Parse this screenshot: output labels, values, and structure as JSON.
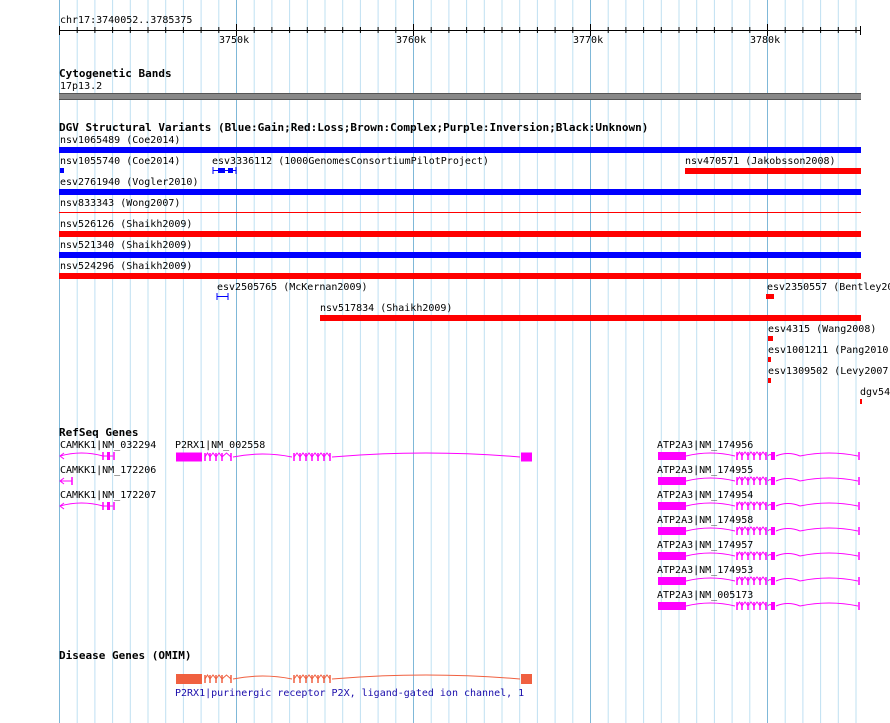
{
  "ruler": {
    "location": "chr17:3740052..3785375",
    "ticks": [
      "3750k",
      "3760k",
      "3770k",
      "3780k"
    ]
  },
  "cytoband": {
    "title": "Cytogenetic Bands",
    "band_label": "17p13.2"
  },
  "dgv": {
    "title": "DGV Structural Variants (Blue:Gain;Red:Loss;Brown:Complex;Purple:Inversion;Black:Unknown)",
    "colors": {
      "gain": "#0000ff",
      "loss": "#ff0000"
    },
    "variants": [
      {
        "label": "nsv1065489 (Coe2014)",
        "type": "gain"
      },
      {
        "label": "nsv1055740 (Coe2014)",
        "type": "gain"
      },
      {
        "label": "esv3336112 (1000GenomesConsortiumPilotProject)",
        "type": "gain"
      },
      {
        "label": "nsv470571 (Jakobsson2008)",
        "type": "loss"
      },
      {
        "label": "esv2761940 (Vogler2010)",
        "type": "gain"
      },
      {
        "label": "nsv833343 (Wong2007)",
        "type": "loss"
      },
      {
        "label": "nsv526126 (Shaikh2009)",
        "type": "loss"
      },
      {
        "label": "nsv521340 (Shaikh2009)",
        "type": "gain"
      },
      {
        "label": "nsv524296 (Shaikh2009)",
        "type": "loss"
      },
      {
        "label": "esv2505765 (McKernan2009)",
        "type": "gain"
      },
      {
        "label": "esv2350557 (Bentley20",
        "type": "loss"
      },
      {
        "label": "nsv517834 (Shaikh2009)",
        "type": "loss"
      },
      {
        "label": "esv4315 (Wang2008)",
        "type": "loss"
      },
      {
        "label": "esv1001211 (Pang2010)",
        "type": "loss"
      },
      {
        "label": "esv1309502 (Levy2007",
        "type": "loss"
      },
      {
        "label": "dgv54",
        "type": "loss"
      }
    ]
  },
  "refseq": {
    "title": "RefSeq Genes",
    "color": "#ff00ff",
    "genes": [
      {
        "label": "CAMKK1|NM_032294"
      },
      {
        "label": "P2RX1|NM_002558"
      },
      {
        "label": "CAMKK1|NM_172206"
      },
      {
        "label": "CAMKK1|NM_172207"
      },
      {
        "label": "ATP2A3|NM_174956"
      },
      {
        "label": "ATP2A3|NM_174955"
      },
      {
        "label": "ATP2A3|NM_174954"
      },
      {
        "label": "ATP2A3|NM_174958"
      },
      {
        "label": "ATP2A3|NM_174957"
      },
      {
        "label": "ATP2A3|NM_174953"
      },
      {
        "label": "ATP2A3|NM_005173"
      }
    ]
  },
  "omim": {
    "title": "Disease Genes (OMIM)",
    "color": "#f06040",
    "gene_label": "P2RX1|purinergic receptor P2X, ligand-gated ion channel, 1"
  }
}
